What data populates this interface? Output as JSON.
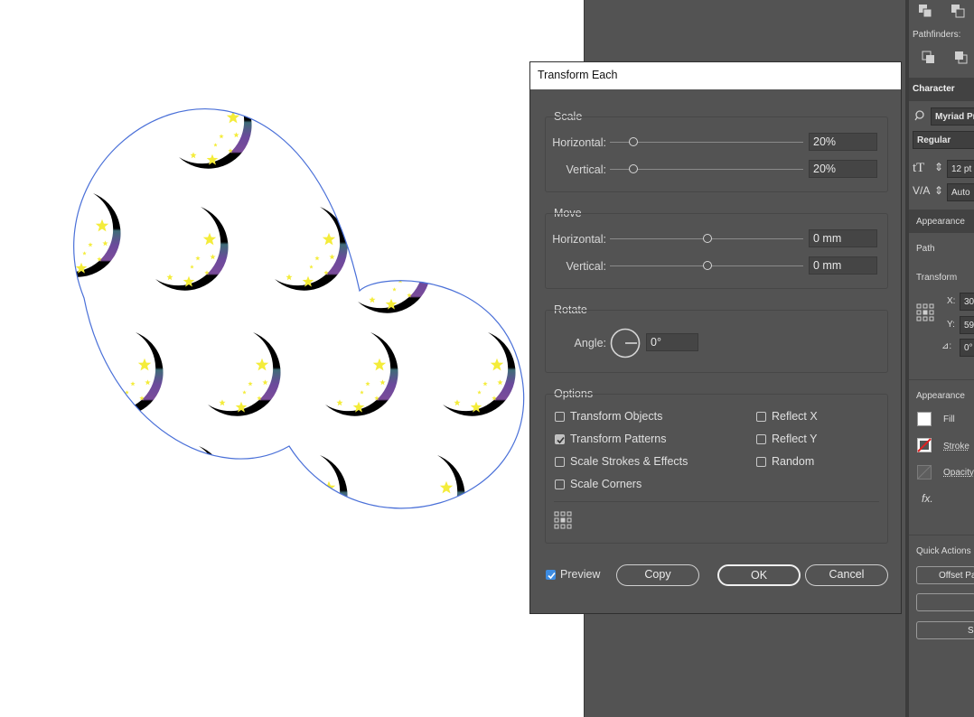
{
  "dialog": {
    "title": "Transform Each",
    "scale": {
      "label": "Scale",
      "horizontal_label": "Horizontal:",
      "horizontal_value": "20%",
      "vertical_label": "Vertical:",
      "vertical_value": "20%"
    },
    "move": {
      "label": "Move",
      "horizontal_label": "Horizontal:",
      "horizontal_value": "0 mm",
      "vertical_label": "Vertical:",
      "vertical_value": "0 mm"
    },
    "rotate": {
      "label": "Rotate",
      "angle_label": "Angle:",
      "angle_value": "0°"
    },
    "options": {
      "label": "Options",
      "transform_objects": "Transform Objects",
      "transform_patterns": "Transform Patterns",
      "scale_strokes_effects": "Scale Strokes & Effects",
      "scale_corners": "Scale Corners",
      "reflect_x": "Reflect X",
      "reflect_y": "Reflect Y",
      "random": "Random",
      "checked": {
        "transform_objects": false,
        "transform_patterns": true,
        "scale_strokes_effects": false,
        "scale_corners": false,
        "reflect_x": false,
        "reflect_y": false,
        "random": false
      }
    },
    "preview_label": "Preview",
    "preview_checked": true,
    "copy_label": "Copy",
    "ok_label": "OK",
    "cancel_label": "Cancel"
  },
  "panel": {
    "pathfinders_label": "Pathfinders:",
    "character_tab": "Character",
    "font_family": "Myriad Pr",
    "font_style": "Regular",
    "font_size": "12 pt",
    "tracking": "Auto",
    "appearance_tab": "Appearance",
    "path_label": "Path",
    "transform_label": "Transform",
    "x_label": "X:",
    "x_value": "30",
    "y_label": "Y:",
    "y_value": "59",
    "angle_value": "0°",
    "appearance_label": "Appearance",
    "fill_label": "Fill",
    "stroke_label": "Stroke",
    "opacity_label": "Opacity",
    "fx_label": "fx.",
    "quick_actions_label": "Quick Actions",
    "offset_path_label": "Offset Pa",
    "bottom_button_label": "S"
  },
  "colors": {
    "shape_outline": "#4a70d8",
    "moon_black": "#000000",
    "moon_purple": "#6b4a9c",
    "star_yellow": "#f4ec3a",
    "dialog_bg": "#535353",
    "accent_blue": "#3d8ce2"
  }
}
